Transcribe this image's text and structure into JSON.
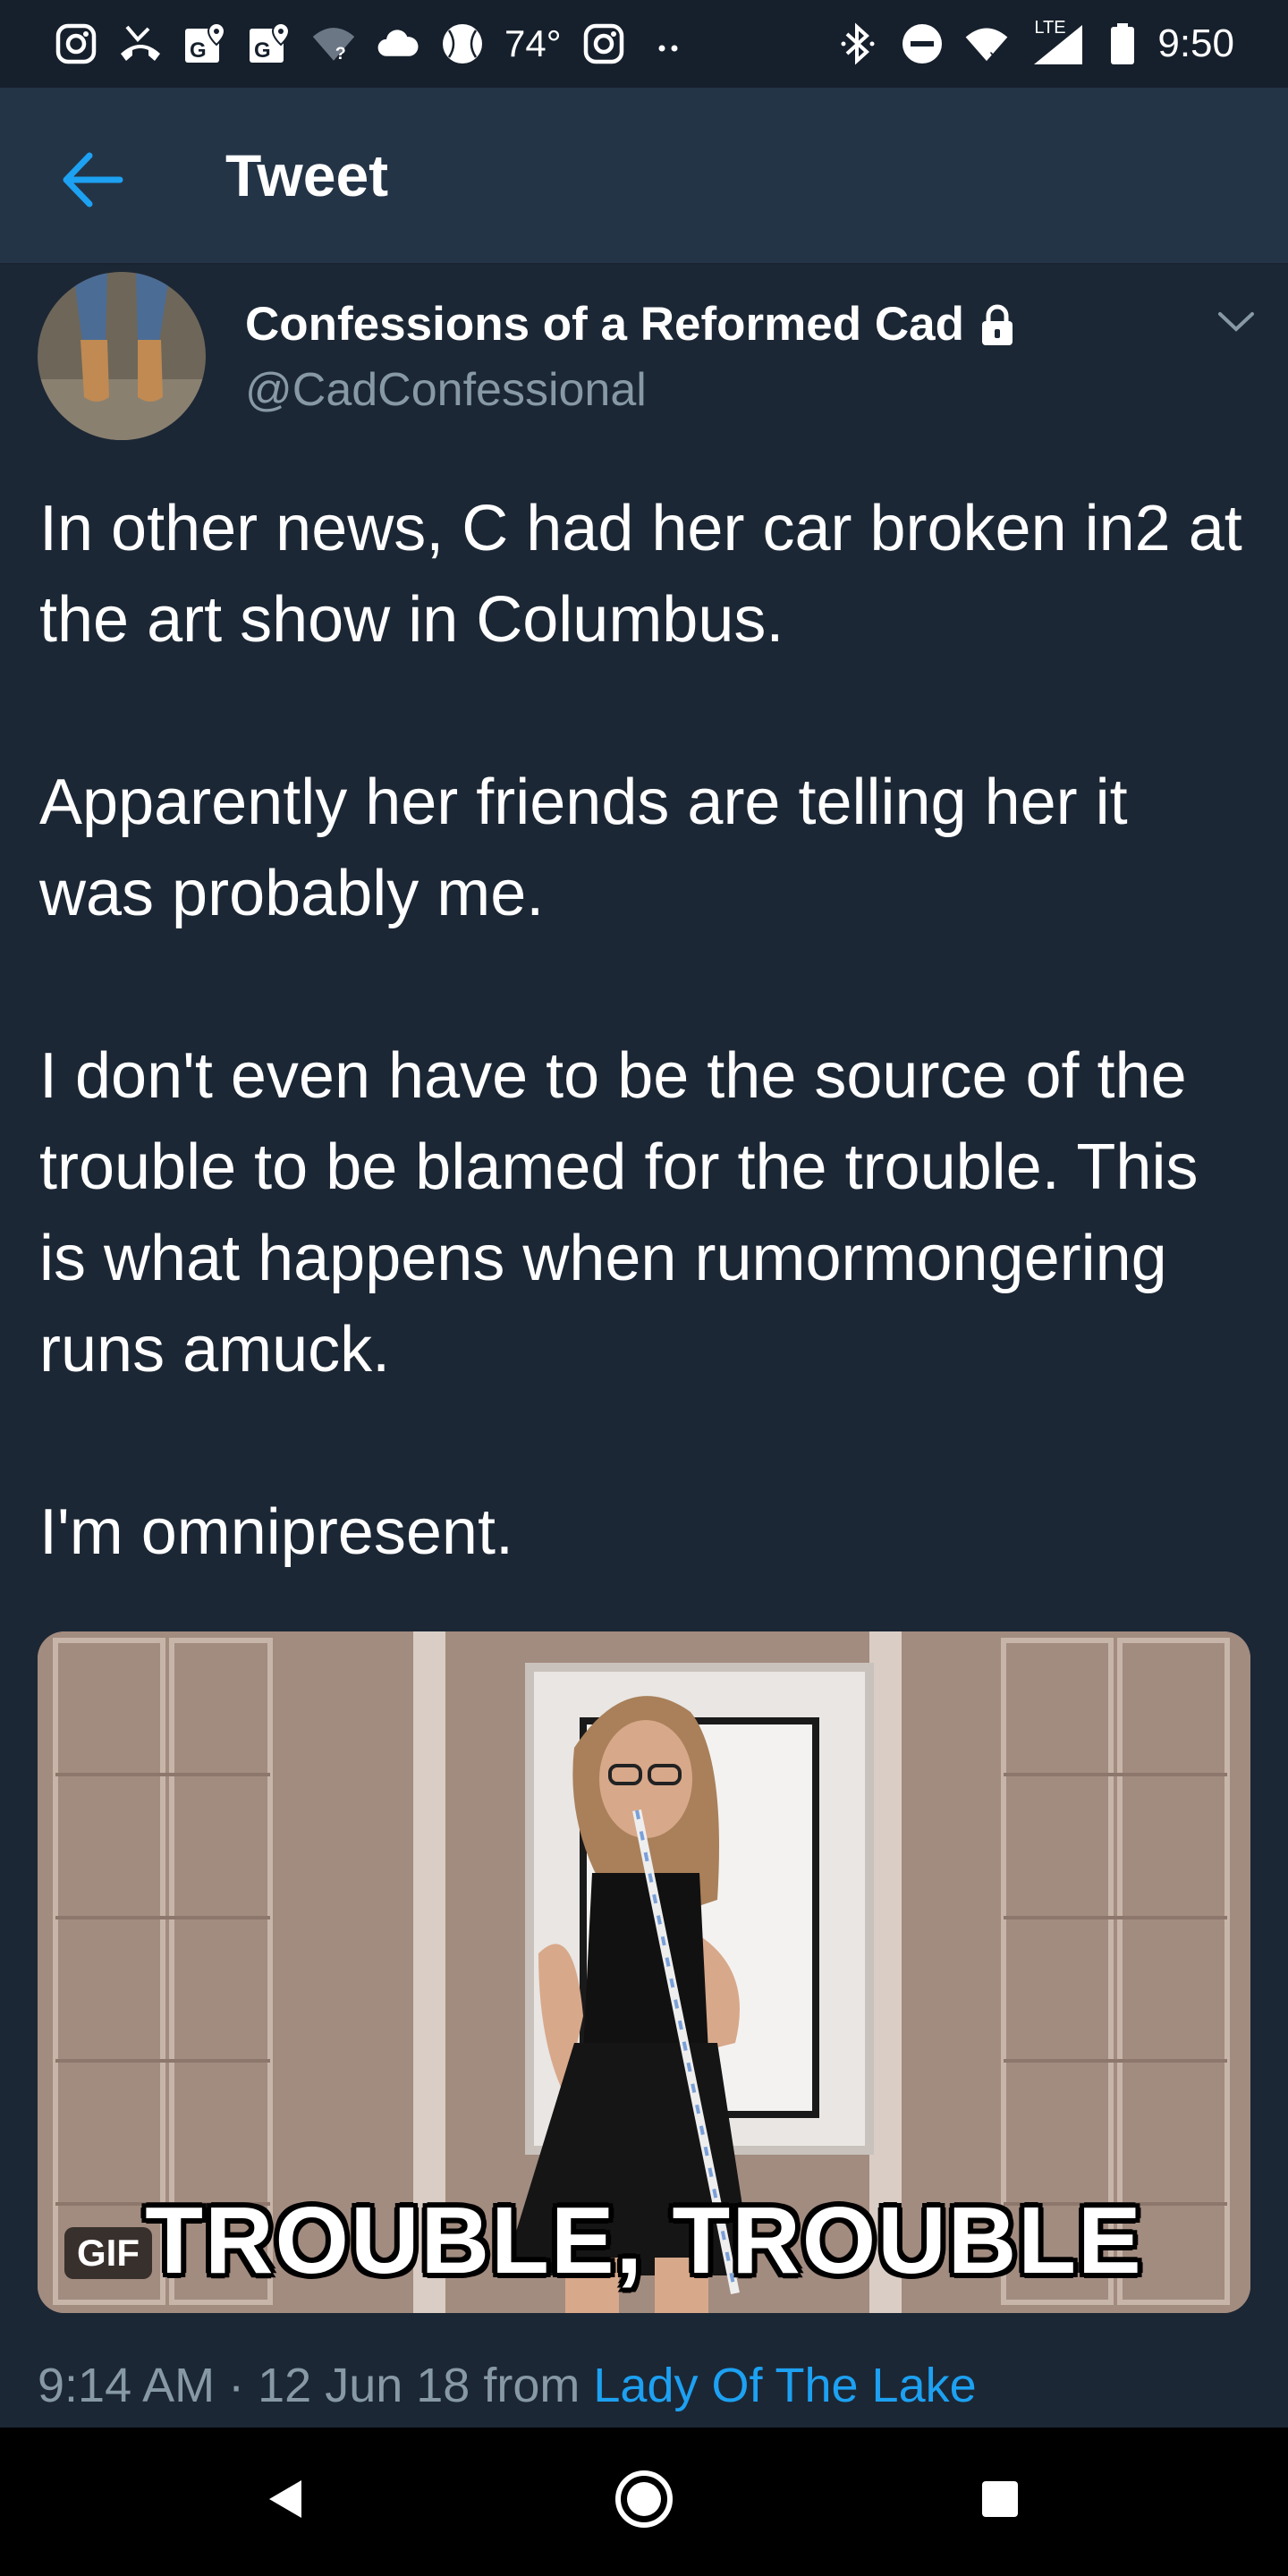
{
  "status_bar": {
    "icons_left": [
      "instagram-icon",
      "missed-call-icon",
      "maps-icon",
      "maps-icon",
      "wifi-question-icon",
      "cloud-icon",
      "baseball-icon"
    ],
    "temperature": "74°",
    "icons_right": [
      "instagram-icon",
      "more-dots-icon",
      "bluetooth-icon",
      "do-not-disturb-icon",
      "wifi-icon",
      "lte-signal-icon",
      "battery-icon"
    ],
    "network_label": "LTE",
    "time": "9:50"
  },
  "header": {
    "back_icon": "arrow-left-icon",
    "title": "Tweet"
  },
  "tweet": {
    "author_name": "Confessions of a Reformed Cad",
    "author_handle": "@CadConfessional",
    "protected_icon": "lock-icon",
    "menu_icon": "chevron-down-icon",
    "paragraphs": [
      "In other news, C had her car broken in2 at the art show in Columbus.",
      "Apparently her friends are telling her it was probably me.",
      "I don't even have to be the source of the trouble to be blamed for the trouble. This is what happens when rumormongering runs amuck.",
      "I'm omnipresent."
    ],
    "media": {
      "badge": "GIF",
      "caption": "TROUBLE, TROUBLE"
    },
    "time": "9:14 AM",
    "separator": "·",
    "date": "12 Jun 18",
    "from_label": "from",
    "source": "Lady Of The Lake"
  },
  "nav_bar": {
    "buttons": [
      "back-triangle-icon",
      "home-circle-icon",
      "recents-square-icon"
    ]
  },
  "colors": {
    "background": "#1c2735",
    "header": "#243447",
    "accent": "#1da1f2",
    "secondary_text": "#8899a6"
  }
}
